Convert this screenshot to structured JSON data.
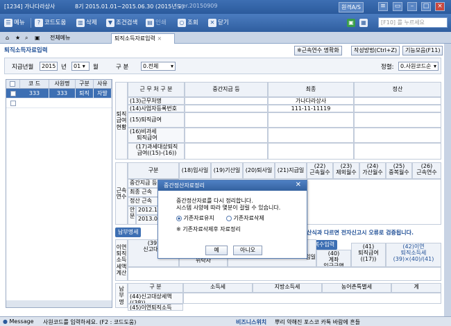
{
  "titlebar": {
    "app_title": "[1234] 가나다라상사",
    "period": "8기  2015.01.01~2015.06.30  (2015년도)",
    "version": "ver.20150909",
    "help_button": "원격A/S"
  },
  "toolbar": {
    "menu": "메뉴",
    "help": "코드도움",
    "delete": "삭제",
    "condition_search": "조건검색",
    "print": "인쇄",
    "lookup": "조회",
    "close": "닫기",
    "search_placeholder": "[F10] 를 누르세요"
  },
  "tabs": {
    "all_menu": "전체메뉴",
    "active": "퇴직소득자료입력"
  },
  "page": {
    "title": "퇴직소득자료입력",
    "btn_service_calc": "※근속연수 명확화",
    "btn_howto": "작성방법(Ctrl+Z)",
    "btn_features": "기능모음(F11)"
  },
  "filter": {
    "pay_year_label": "지급년월",
    "year": "2015",
    "year_unit": "년",
    "month": "01",
    "month_unit": "월",
    "type_label": "구   분",
    "type_value": "0.전체",
    "sort_label": "정렬:",
    "sort_value": "0.사원코드순"
  },
  "left_grid": {
    "headers": [
      "코 드",
      "사원명",
      "구분",
      "사유"
    ],
    "rows": [
      {
        "code": "333",
        "name": "333",
        "type": "퇴직",
        "reason": "자발"
      }
    ]
  },
  "workplace": {
    "side": "퇴직\n급여\n현황",
    "header_category": "근 무 처 구 분",
    "header_interim": "중간지급 등",
    "header_final": "최종",
    "header_settle": "정산",
    "rows": [
      {
        "label": "(13)근무처명",
        "final": "가나다라상사"
      },
      {
        "label": "(14)사업자등록번호",
        "final": "111-11-11119"
      },
      {
        "label": "(15)퇴직급여",
        "final": ""
      },
      {
        "label": "(16)비과세\n    퇴직급여",
        "final": ""
      },
      {
        "label": "(17)과세대상퇴직\n급여((15)-(16))",
        "final": ""
      }
    ]
  },
  "service_years": {
    "side": "근속\n연수",
    "headers": [
      "구분",
      "(18)입사일",
      "(19)기산일",
      "(20)퇴사일",
      "(21)지급일",
      "(22)\n근속월수",
      "(23)\n제외월수",
      "(24)\n가산월수",
      "(25)\n중복월수",
      "(26)\n근속연수"
    ],
    "rows": [
      "중간지급 등",
      "최종 근속",
      "정산 근속",
      "2012.1",
      "2013.0"
    ],
    "sub_label_1": "안",
    "sub_label_2": "분"
  },
  "tax_calc": {
    "tab_button": "납부명세",
    "warning": "산식과 다르면 전자신고시 오류로 검증됩니다.",
    "copy_button": "금계좌 복수입력",
    "side": "이연\n퇴직\n소득\n세액\n계산",
    "col_39": "(39)\n신고대상",
    "col_payer": "위탁자",
    "col_month": "입일",
    "col_40": "(40)\n계좌\n입금금액",
    "col_41": "(41)\n퇴직급여\n((17))",
    "col_42": "(42)이연\n퇴직소득세\n(39)×(40)/(41)"
  },
  "payment": {
    "side": "납\n부\n명",
    "headers": [
      "구 분",
      "소득세",
      "지방소득세",
      "농어촌특별세",
      "계"
    ],
    "rows": [
      "(44)신고대상세액\n((38))",
      "(45)이연퇴직소득"
    ]
  },
  "dialog": {
    "title": "중간정산자료정리",
    "message_1": "중간정산자료를 다시 정리합니다.",
    "message_2": "시스템 사양에 따라 몇분이 걸릴 수 있습니다.",
    "option_keep": "기존자료유지",
    "option_delete": "기존자료삭제",
    "selected": "keep",
    "note": "※ 기존자료삭제후 자료정리",
    "yes": "예",
    "no": "아니오"
  },
  "statusbar": {
    "message_label": "Message",
    "message_text": "사원코드를 입력하세요. (F2 : 코드도움)",
    "business_label": "비즈니스위치",
    "business_text": "뿌리 약해진 포스코 카툭 바람에 흔들"
  }
}
